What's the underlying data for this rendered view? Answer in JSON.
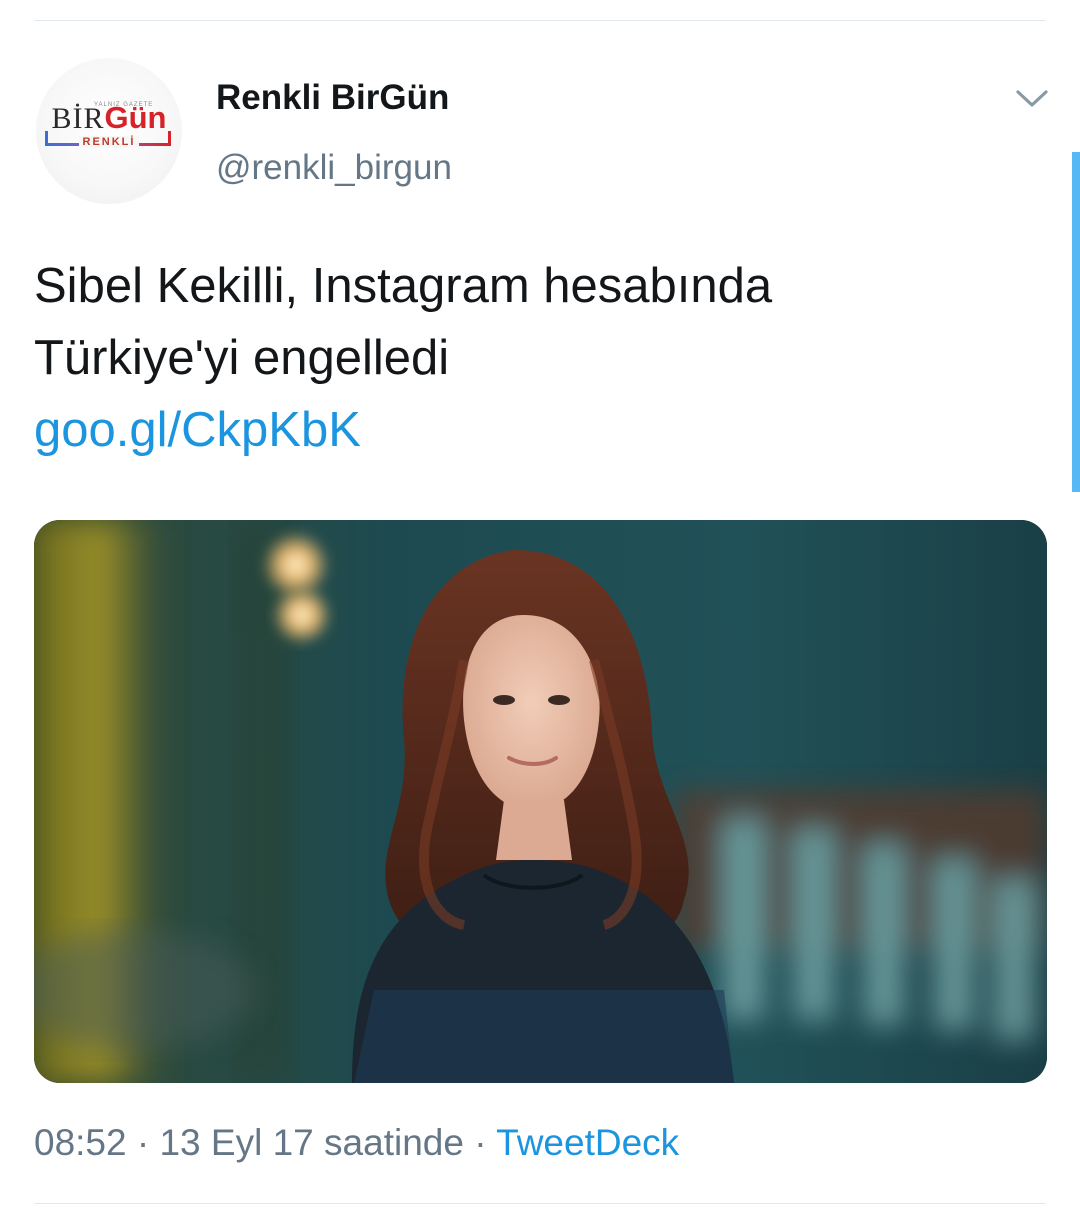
{
  "tweet": {
    "display_name": "Renkli BirGün",
    "handle": "@renkli_birgun",
    "avatar": {
      "logo_main": "BirGün",
      "logo_bir": "BİR",
      "logo_gun": "Gün",
      "logo_sub": "RENKLİ",
      "logo_tagline": "YALNIZ GAZETE"
    },
    "text_line1": "Sibel Kekilli, Instagram hesabında",
    "text_line2": "Türkiye'yi engelledi",
    "link": "goo.gl/CkpKbK",
    "media_icon": "photo",
    "time": "08:52",
    "separator": "·",
    "date_phrase": "13 Eyl 17 saatinde",
    "source": "TweetDeck"
  },
  "icons": {
    "more": "chevron-down-icon"
  },
  "colors": {
    "link": "#1b95e0",
    "muted": "#657786",
    "text": "#14171a",
    "divider": "#e1e8ed",
    "scrollbar": "#1da1f2"
  }
}
